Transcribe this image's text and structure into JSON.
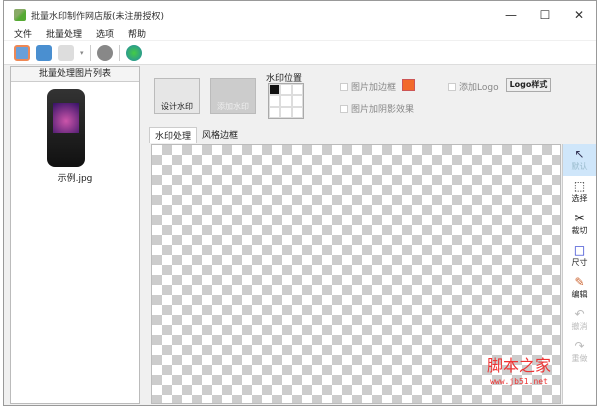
{
  "window": {
    "title": "批量水印制作网店版(未注册授权)",
    "minimize": "—",
    "maximize": "☐",
    "close": "✕"
  },
  "menu": [
    "文件",
    "批量处理",
    "选项",
    "帮助"
  ],
  "toolbar": [
    "add-image-icon",
    "add-folder-icon",
    "save-icon",
    "settings-icon",
    "run-icon"
  ],
  "left_panel": {
    "header": "批量处理图片列表",
    "items": [
      {
        "label": "示例.jpg"
      }
    ]
  },
  "controls": {
    "design_watermark": "设计水印",
    "add_watermark": "添加水印",
    "position_label": "水印位置",
    "add_border": "图片加边框",
    "add_shadow": "图片加阴影效果",
    "add_logo": "添加Logo",
    "logo_style": "Logo样式",
    "border_color": "#f26a2a",
    "selected_position": "top-left"
  },
  "tabs": [
    "水印处理",
    "风格边框"
  ],
  "side_tools": [
    {
      "label": "默认",
      "icon": "↖"
    },
    {
      "label": "选择",
      "icon": "⬚"
    },
    {
      "label": "裁切",
      "icon": "✂"
    },
    {
      "label": "尺寸",
      "icon": "□"
    },
    {
      "label": "编辑",
      "icon": "✎"
    },
    {
      "label": "撤消",
      "icon": "↶"
    },
    {
      "label": "重做",
      "icon": "↷"
    }
  ],
  "watermark": {
    "text": "脚本之家",
    "url": "www.jb51.net"
  }
}
